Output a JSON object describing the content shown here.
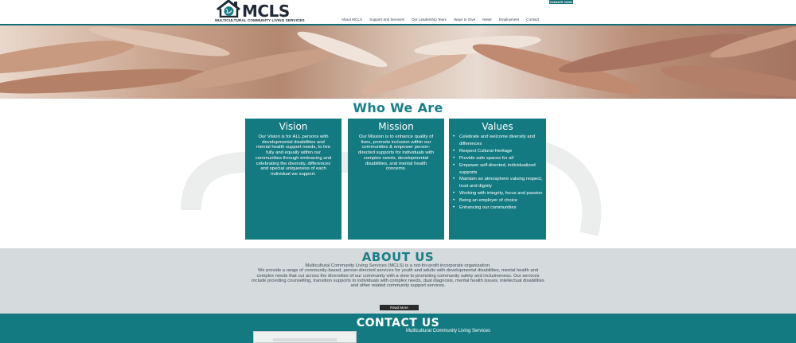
{
  "header": {
    "logo_text": "MCLS",
    "logo_tagline": "MULTICULTURAL COMMUNITY LIVING SERVICES",
    "donate_label": "DONATE NOW",
    "nav": [
      "About MCLS",
      "Support and Services",
      "Our Leadership Team",
      "Ways to Give",
      "News",
      "Employment",
      "Contact"
    ]
  },
  "who": {
    "title": "Who We Are",
    "vision": {
      "title": "Vision",
      "text": "Our Vision is for ALL persons with developmental disabilities and mental health support needs, to live fully and equally within our communities through embracing and celebrating the diversity, differences and special uniqueness of each individual we support."
    },
    "mission": {
      "title": "Mission",
      "text": "Our Mission is to enhance quality of lives, promote inclusion within our communities & empower person-directed supports for individuals with complex needs, developmental disabilities, and mental health concerns."
    },
    "values": {
      "title": "Values",
      "items": [
        "Celebrate and welcome diversity and differences",
        "Respect Cultural Heritage",
        "Provide safe spaces for all",
        "Empower self-directed, individualized supports",
        "Maintain an atmosphere valuing respect, trust and dignity",
        "Working with integrity, focus and passion",
        "Being an employer of choice",
        "Enhancing our communities"
      ]
    }
  },
  "about": {
    "title": "ABOUT US",
    "line1": "Multicultural Community Living Services (MCLS) is a not-for-profit incorporate organization.",
    "line2": "We provide a range of community-based, person-directed services for youth and adults with developmental disabilities, mental health and complex needs that cut across the diversities of our community with a view to promoting community safety and inclusiveness. Our services include providing counselling, transition supports to individuals with complex needs, dual diagnosis, mental health issues, intellectual disabilities and other related community support services.",
    "button": "Read More"
  },
  "contact": {
    "title": "CONTACT US",
    "org": "Multicultural Community Living Services"
  },
  "colors": {
    "teal": "#137a82",
    "teal_text": "#1a7f88",
    "gray_band": "#d5dadd",
    "navy": "#1f2a36"
  }
}
